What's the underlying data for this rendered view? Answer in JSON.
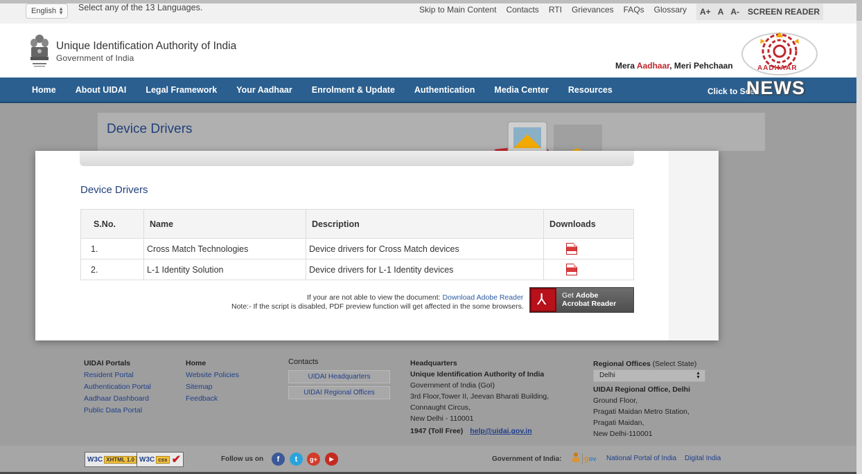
{
  "topbar": {
    "language": "English",
    "language_note": "Select any of the 13 Languages.",
    "links": [
      "Skip to Main Content",
      "Contacts",
      "RTI",
      "Grievances",
      "FAQs",
      "Glossary"
    ],
    "font_controls": [
      "A+",
      "A",
      "A-"
    ],
    "screen_reader": "SCREEN READER"
  },
  "header": {
    "org_name": "Unique Identification Authority of India",
    "org_sub": "Government of India",
    "tagline_pre": "Mera ",
    "tagline_brand": "Aadhaar",
    "tagline_post": ", Meri Pehchaan",
    "logo_text": "AADHAAR"
  },
  "nav": {
    "items": [
      "Home",
      "About UIDAI",
      "Legal Framework",
      "Your Aadhaar",
      "Enrolment & Update",
      "Authentication",
      "Media Center",
      "Resources"
    ],
    "click_to_see": "Click to See",
    "news": "NEWS"
  },
  "page": {
    "title": "Device Drivers",
    "section_title": "Device Drivers"
  },
  "table": {
    "headers": [
      "S.No.",
      "Name",
      "Description",
      "Downloads"
    ],
    "rows": [
      {
        "sno": "1.",
        "name": "Cross Match Technologies",
        "description": "Device drivers for Cross Match devices"
      },
      {
        "sno": "2.",
        "name": "L-1 Identity Solution",
        "description": "Device drivers for L-1 Identity devices"
      }
    ]
  },
  "pdf_note": {
    "line1_pre": "If your are not able to view the document: ",
    "line1_link": "Download Adobe Reader",
    "line2": "Note:- If the script is disabled, PDF preview function will get affected in the some browsers.",
    "acrobat_l1_pre": "Get ",
    "acrobat_l1_bold": "Adobe",
    "acrobat_l2": "Acrobat Reader"
  },
  "footer": {
    "portals": {
      "heading": "UIDAI Portals",
      "links": [
        "Resident Portal",
        "Authentication Portal",
        "Aadhaar Dashboard",
        "Public Data Portal"
      ]
    },
    "home": {
      "heading": "Home",
      "links": [
        "Website Policies",
        "Sitemap",
        "Feedback"
      ]
    },
    "contacts": {
      "heading": "Contacts",
      "buttons": [
        "UIDAI Headquarters",
        "UIDAI Regional Offices"
      ]
    },
    "hq": {
      "heading": "Headquarters",
      "name": "Unique Identification Authority of India",
      "lines": [
        "Government of India (GoI)",
        "3rd Floor,Tower II, Jeevan Bharati Building,",
        "Connaught Circus,",
        "New Delhi - 110001"
      ],
      "tollfree": "1947 (Toll Free)",
      "email": "help@uidai.gov.in"
    },
    "regional": {
      "heading": "Regional Offices",
      "heading_note": " (Select State)",
      "selected": "Delhi",
      "office_name": "UIDAI Regional Office, Delhi",
      "lines": [
        "Ground Floor,",
        "Pragati Maidan Metro Station,",
        "Pragati Maidan,",
        "New Delhi-110001"
      ]
    }
  },
  "bottom": {
    "w3c_xhtml": "XHTML 1.0",
    "w3c_css": "css",
    "follow": "Follow us on",
    "goi": "Government of India:",
    "national_portal": "National Portal of India",
    "digital_india": "Digital India"
  }
}
